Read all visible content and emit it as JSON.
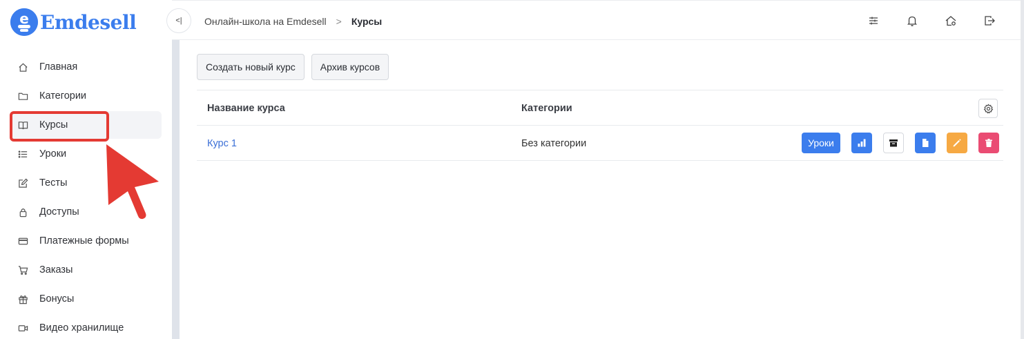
{
  "logo": {
    "text": "Emdesell",
    "mark_letter": "e"
  },
  "sidebar": {
    "items": [
      {
        "label": "Главная",
        "icon": "home-icon"
      },
      {
        "label": "Категории",
        "icon": "folder-icon"
      },
      {
        "label": "Курсы",
        "icon": "book-icon",
        "active": true
      },
      {
        "label": "Уроки",
        "icon": "list-icon"
      },
      {
        "label": "Тесты",
        "icon": "edit-icon"
      },
      {
        "label": "Доступы",
        "icon": "lock-icon"
      },
      {
        "label": "Платежные формы",
        "icon": "credit-card-icon"
      },
      {
        "label": "Заказы",
        "icon": "cart-icon"
      },
      {
        "label": "Бонусы",
        "icon": "gift-icon"
      },
      {
        "label": "Видео хранилище",
        "icon": "video-icon"
      }
    ]
  },
  "header": {
    "collapse_label": "<|",
    "breadcrumb": {
      "parent": "Онлайн-школа на Emdesell",
      "separator": ">",
      "current": "Курсы"
    },
    "icons": [
      "sliders-icon",
      "bell-icon",
      "home-settings-icon",
      "logout-icon"
    ]
  },
  "toolbar": {
    "create_label": "Создать новый курс",
    "archive_label": "Архив курсов"
  },
  "table": {
    "headers": {
      "name": "Название курса",
      "categories": "Категории"
    },
    "rows": [
      {
        "name": "Курс 1",
        "category": "Без категории",
        "lessons_label": "Уроки"
      }
    ]
  },
  "colors": {
    "accent": "#3b7ded",
    "highlight": "#e43a33",
    "edit": "#f6a943",
    "delete": "#ea4c73",
    "link": "#3b6fd6"
  }
}
